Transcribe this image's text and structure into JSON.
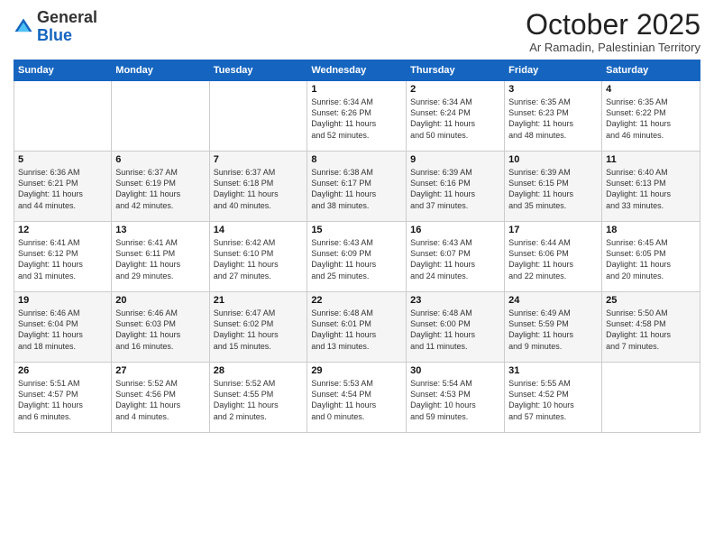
{
  "header": {
    "logo_general": "General",
    "logo_blue": "Blue",
    "month": "October 2025",
    "location": "Ar Ramadin, Palestinian Territory"
  },
  "days_of_week": [
    "Sunday",
    "Monday",
    "Tuesday",
    "Wednesday",
    "Thursday",
    "Friday",
    "Saturday"
  ],
  "weeks": [
    [
      {
        "num": "",
        "info": ""
      },
      {
        "num": "",
        "info": ""
      },
      {
        "num": "",
        "info": ""
      },
      {
        "num": "1",
        "info": "Sunrise: 6:34 AM\nSunset: 6:26 PM\nDaylight: 11 hours\nand 52 minutes."
      },
      {
        "num": "2",
        "info": "Sunrise: 6:34 AM\nSunset: 6:24 PM\nDaylight: 11 hours\nand 50 minutes."
      },
      {
        "num": "3",
        "info": "Sunrise: 6:35 AM\nSunset: 6:23 PM\nDaylight: 11 hours\nand 48 minutes."
      },
      {
        "num": "4",
        "info": "Sunrise: 6:35 AM\nSunset: 6:22 PM\nDaylight: 11 hours\nand 46 minutes."
      }
    ],
    [
      {
        "num": "5",
        "info": "Sunrise: 6:36 AM\nSunset: 6:21 PM\nDaylight: 11 hours\nand 44 minutes."
      },
      {
        "num": "6",
        "info": "Sunrise: 6:37 AM\nSunset: 6:19 PM\nDaylight: 11 hours\nand 42 minutes."
      },
      {
        "num": "7",
        "info": "Sunrise: 6:37 AM\nSunset: 6:18 PM\nDaylight: 11 hours\nand 40 minutes."
      },
      {
        "num": "8",
        "info": "Sunrise: 6:38 AM\nSunset: 6:17 PM\nDaylight: 11 hours\nand 38 minutes."
      },
      {
        "num": "9",
        "info": "Sunrise: 6:39 AM\nSunset: 6:16 PM\nDaylight: 11 hours\nand 37 minutes."
      },
      {
        "num": "10",
        "info": "Sunrise: 6:39 AM\nSunset: 6:15 PM\nDaylight: 11 hours\nand 35 minutes."
      },
      {
        "num": "11",
        "info": "Sunrise: 6:40 AM\nSunset: 6:13 PM\nDaylight: 11 hours\nand 33 minutes."
      }
    ],
    [
      {
        "num": "12",
        "info": "Sunrise: 6:41 AM\nSunset: 6:12 PM\nDaylight: 11 hours\nand 31 minutes."
      },
      {
        "num": "13",
        "info": "Sunrise: 6:41 AM\nSunset: 6:11 PM\nDaylight: 11 hours\nand 29 minutes."
      },
      {
        "num": "14",
        "info": "Sunrise: 6:42 AM\nSunset: 6:10 PM\nDaylight: 11 hours\nand 27 minutes."
      },
      {
        "num": "15",
        "info": "Sunrise: 6:43 AM\nSunset: 6:09 PM\nDaylight: 11 hours\nand 25 minutes."
      },
      {
        "num": "16",
        "info": "Sunrise: 6:43 AM\nSunset: 6:07 PM\nDaylight: 11 hours\nand 24 minutes."
      },
      {
        "num": "17",
        "info": "Sunrise: 6:44 AM\nSunset: 6:06 PM\nDaylight: 11 hours\nand 22 minutes."
      },
      {
        "num": "18",
        "info": "Sunrise: 6:45 AM\nSunset: 6:05 PM\nDaylight: 11 hours\nand 20 minutes."
      }
    ],
    [
      {
        "num": "19",
        "info": "Sunrise: 6:46 AM\nSunset: 6:04 PM\nDaylight: 11 hours\nand 18 minutes."
      },
      {
        "num": "20",
        "info": "Sunrise: 6:46 AM\nSunset: 6:03 PM\nDaylight: 11 hours\nand 16 minutes."
      },
      {
        "num": "21",
        "info": "Sunrise: 6:47 AM\nSunset: 6:02 PM\nDaylight: 11 hours\nand 15 minutes."
      },
      {
        "num": "22",
        "info": "Sunrise: 6:48 AM\nSunset: 6:01 PM\nDaylight: 11 hours\nand 13 minutes."
      },
      {
        "num": "23",
        "info": "Sunrise: 6:48 AM\nSunset: 6:00 PM\nDaylight: 11 hours\nand 11 minutes."
      },
      {
        "num": "24",
        "info": "Sunrise: 6:49 AM\nSunset: 5:59 PM\nDaylight: 11 hours\nand 9 minutes."
      },
      {
        "num": "25",
        "info": "Sunrise: 5:50 AM\nSunset: 4:58 PM\nDaylight: 11 hours\nand 7 minutes."
      }
    ],
    [
      {
        "num": "26",
        "info": "Sunrise: 5:51 AM\nSunset: 4:57 PM\nDaylight: 11 hours\nand 6 minutes."
      },
      {
        "num": "27",
        "info": "Sunrise: 5:52 AM\nSunset: 4:56 PM\nDaylight: 11 hours\nand 4 minutes."
      },
      {
        "num": "28",
        "info": "Sunrise: 5:52 AM\nSunset: 4:55 PM\nDaylight: 11 hours\nand 2 minutes."
      },
      {
        "num": "29",
        "info": "Sunrise: 5:53 AM\nSunset: 4:54 PM\nDaylight: 11 hours\nand 0 minutes."
      },
      {
        "num": "30",
        "info": "Sunrise: 5:54 AM\nSunset: 4:53 PM\nDaylight: 10 hours\nand 59 minutes."
      },
      {
        "num": "31",
        "info": "Sunrise: 5:55 AM\nSunset: 4:52 PM\nDaylight: 10 hours\nand 57 minutes."
      },
      {
        "num": "",
        "info": ""
      }
    ]
  ]
}
